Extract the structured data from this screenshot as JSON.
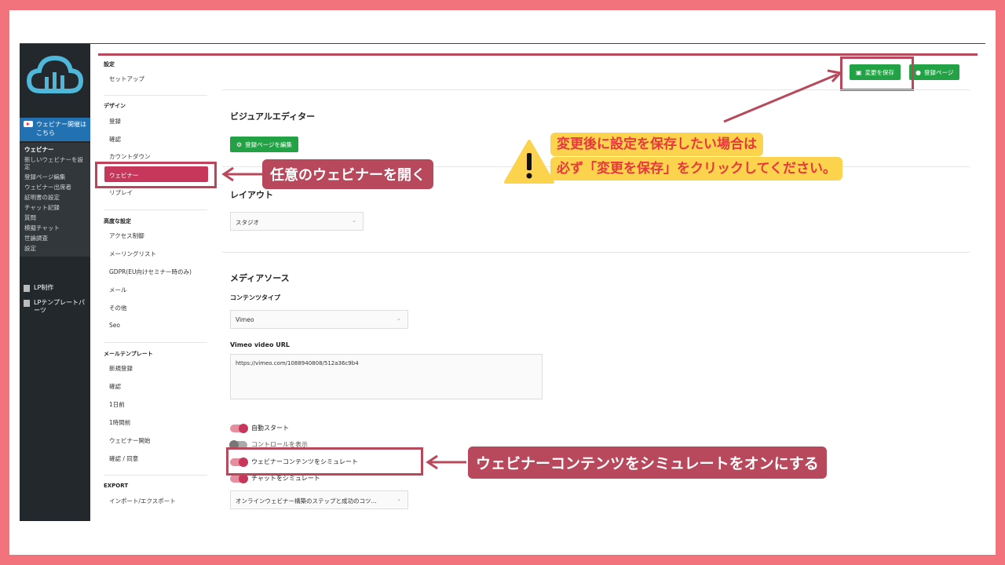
{
  "wp_sidebar": {
    "webinar_header": "ウェビナー開催はこちら",
    "sub_items": [
      "ウェビナー",
      "新しいウェビナーを設定",
      "登録ページ編集",
      "ウェビナー出席者",
      "証明書の設定",
      "チャット記録",
      "質問",
      "模擬チャット",
      "世論調査",
      "設定"
    ],
    "lp_make": "LP制作",
    "lp_template": "LPテンプレートパーツ"
  },
  "settings_nav": {
    "sections": [
      {
        "title": "設定",
        "items": [
          "セットアップ"
        ]
      },
      {
        "title": "デザイン",
        "items": [
          "登録",
          "確認",
          "カウントダウン",
          "ウェビナー",
          "リプレイ"
        ]
      },
      {
        "title": "高度な設定",
        "items": [
          "アクセス制御",
          "メーリングリスト",
          "GDPR(EU向けセミナー時のみ)",
          "メール",
          "その他",
          "Seo"
        ]
      },
      {
        "title": "メールテンプレート",
        "items": [
          "新規登録",
          "確認",
          "1日前",
          "1時間前",
          "ウェビナー開始",
          "確認 / 同意"
        ]
      },
      {
        "title": "EXPORT",
        "items": [
          "インポート/エクスポート"
        ]
      }
    ]
  },
  "toolbar": {
    "save_label": "変更を保存",
    "reg_page_label": "登録ページ"
  },
  "visual_editor": {
    "heading": "ビジュアルエディター",
    "edit_button": "登録ページを編集"
  },
  "layout": {
    "heading": "レイアウト",
    "value": "スタジオ"
  },
  "media": {
    "heading": "メディアソース",
    "content_type_label": "コンテンツタイプ",
    "content_type_value": "Vimeo",
    "url_label": "Vimeo video URL",
    "url_value": "https://vimeo.com/1088940808/512a36c9b4"
  },
  "toggles": [
    {
      "label": "自動スタート",
      "on": true
    },
    {
      "label": "コントロールを表示",
      "on": false
    },
    {
      "label": "ウェビナーコンテンツをシミュレート",
      "on": true
    },
    {
      "label": "チャットをシミュレート",
      "on": true
    }
  ],
  "bottom_select": "オンラインウェビナー構築のステップと成功のコツ...",
  "annotations": {
    "open_webinar": "任意のウェビナーを開く",
    "save_line1": "変更後に設定を保存したい場合は",
    "save_line2": "必ず「変更を保存」をクリックしてください。",
    "simulate_on": "ウェビナーコンテンツをシミュレートをオンにする"
  },
  "colors": {
    "background": "#f2737b",
    "accent": "#b8485b",
    "active_item": "#c6375b",
    "button_green": "#22a245",
    "callout_yellow": "#fcd34d",
    "callout_text_red": "#e8383d"
  }
}
